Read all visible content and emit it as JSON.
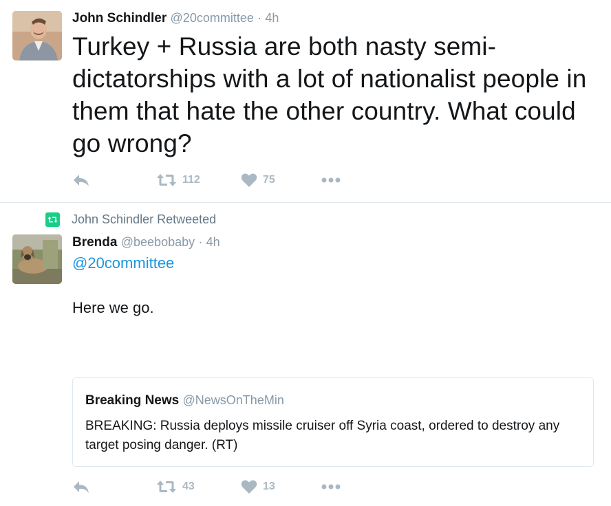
{
  "tweet1": {
    "name": "John Schindler",
    "handle": "@20committee",
    "separator": "·",
    "time": "4h",
    "text": "Turkey + Russia are both nasty semi-dictatorships with a lot of nationalist people in them that hate the other country. What could go wrong?",
    "retweets": "112",
    "likes": "75"
  },
  "retweet_context": {
    "label": "John Schindler Retweeted"
  },
  "tweet2": {
    "name": "Brenda",
    "handle": "@beebobaby",
    "separator": "·",
    "time": "4h",
    "mention": "@20committee",
    "text": "Here we go.",
    "retweets": "43",
    "likes": "13",
    "quote": {
      "name": "Breaking News",
      "handle": "@NewsOnTheMin",
      "text": "BREAKING: Russia deploys missile cruiser off Syria coast, ordered to destroy any target posing danger. (RT)"
    }
  },
  "colors": {
    "link": "#1b95e0",
    "retweet_green": "#19cf86",
    "action_gray": "#aab8c2",
    "meta_gray": "#8899a6"
  },
  "icons": [
    "reply-icon",
    "retweet-icon",
    "heart-icon",
    "more-icon"
  ]
}
